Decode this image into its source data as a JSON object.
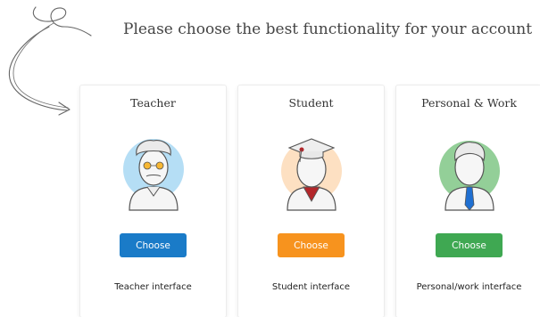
{
  "heading": "Please choose the best functionality for your account",
  "cards": [
    {
      "id": "teacher",
      "title": "Teacher",
      "button_label": "Choose",
      "caption": "Teacher interface",
      "button_color": "#1a7bc8",
      "avatar_bg": "#b5def5",
      "avatar_icon": "teacher-avatar-icon"
    },
    {
      "id": "student",
      "title": "Student",
      "button_label": "Choose",
      "caption": "Student interface",
      "button_color": "#f7931e",
      "avatar_bg": "#fde0c2",
      "avatar_icon": "student-avatar-icon"
    },
    {
      "id": "personal",
      "title": "Personal & Work",
      "button_label": "Choose",
      "caption": "Personal/work interface",
      "button_color": "#3fa852",
      "avatar_bg": "#93cf98",
      "avatar_icon": "personal-work-avatar-icon"
    }
  ]
}
